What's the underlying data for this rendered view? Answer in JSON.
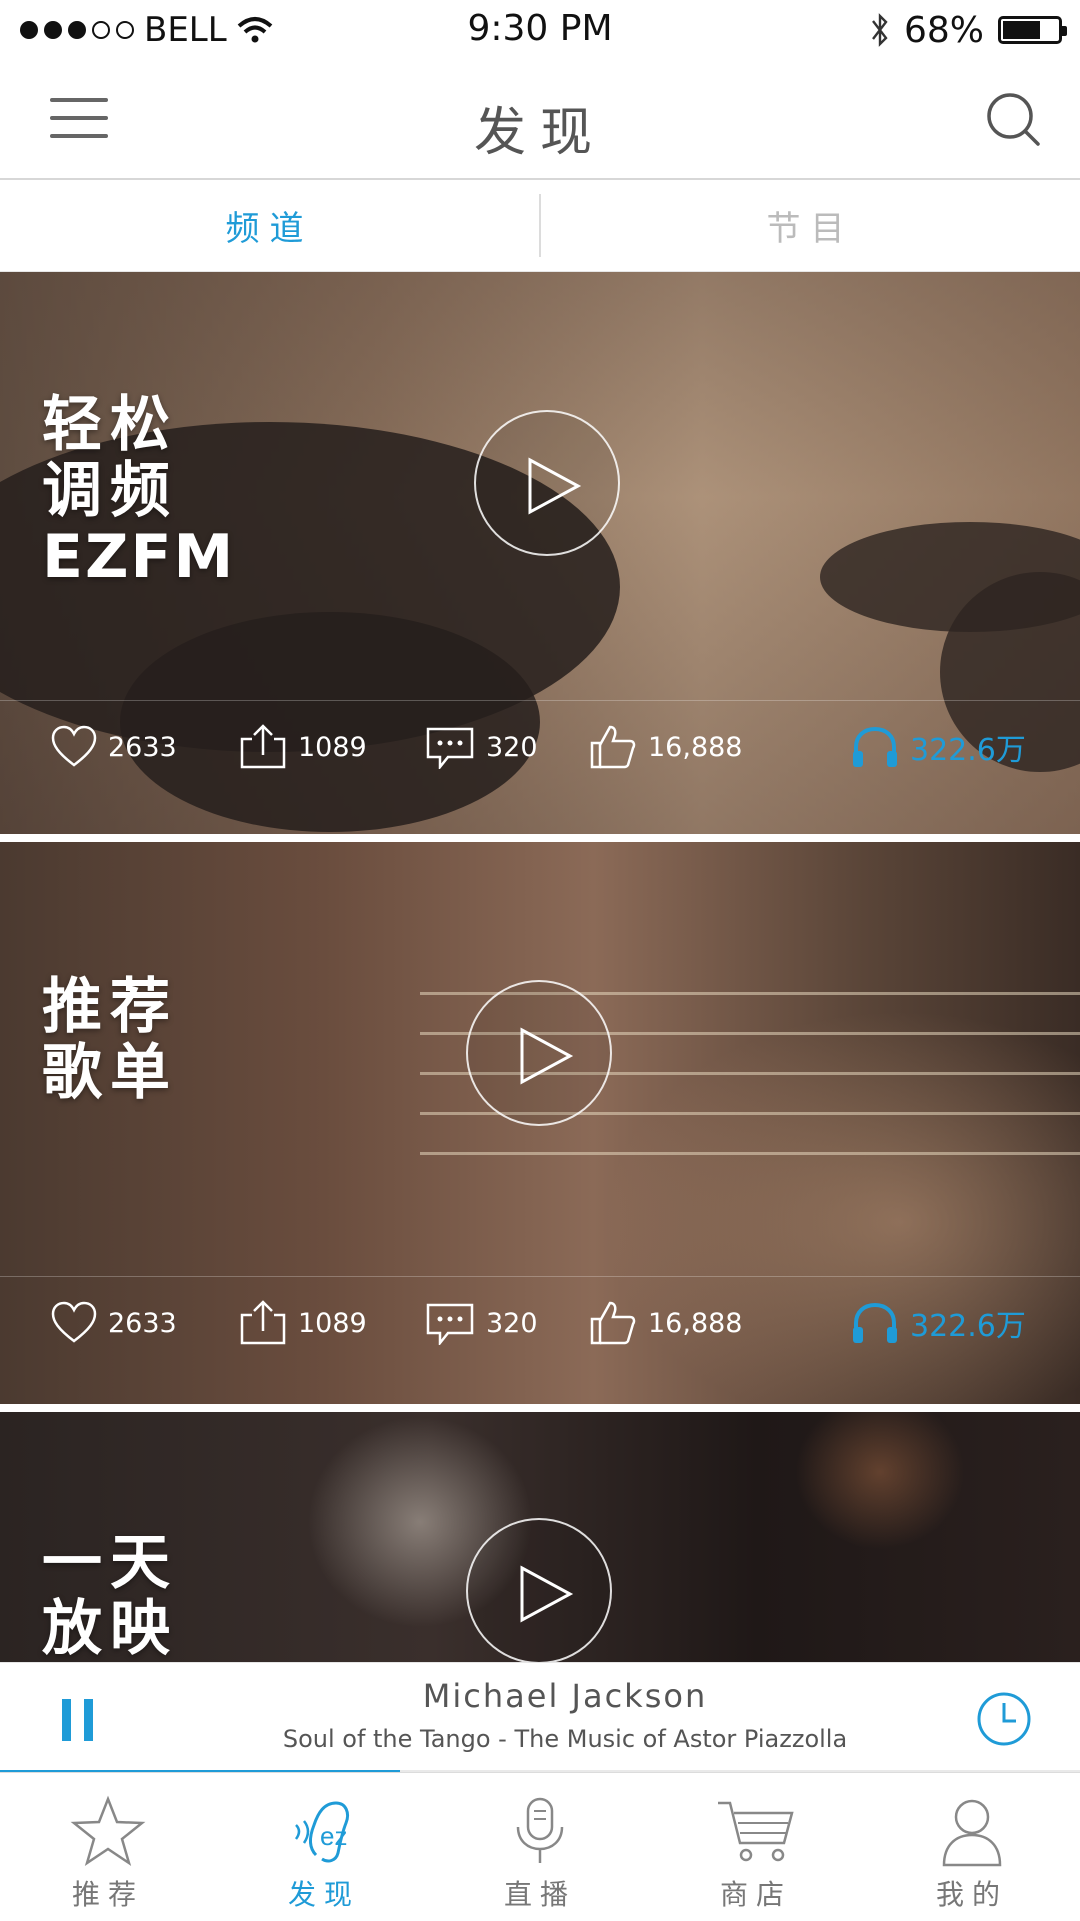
{
  "status_bar": {
    "carrier": "BELL",
    "time": "9:30 PM",
    "battery_percent": "68%",
    "battery_level": 0.68
  },
  "nav": {
    "title": "发现"
  },
  "tabs": [
    {
      "label": "频道",
      "active": true
    },
    {
      "label": "节目",
      "active": false
    }
  ],
  "cards": [
    {
      "title_lines": [
        "轻松",
        "调频",
        "EZFM"
      ],
      "likes": "2633",
      "shares": "1089",
      "comments": "320",
      "thumbs": "16,888",
      "listens": "322.6万"
    },
    {
      "title_lines": [
        "推荐",
        "歌单"
      ],
      "likes": "2633",
      "shares": "1089",
      "comments": "320",
      "thumbs": "16,888",
      "listens": "322.6万"
    },
    {
      "title_lines": [
        "一天",
        "放映"
      ]
    }
  ],
  "player": {
    "artist": "Michael Jackson",
    "song": "Soul of the Tango - The Music of Astor Piazzolla",
    "progress": 0.37
  },
  "tabbar": [
    {
      "label": "推荐",
      "icon": "star-icon",
      "active": false
    },
    {
      "label": "发现",
      "icon": "ez-ear-icon",
      "active": true
    },
    {
      "label": "直播",
      "icon": "microphone-icon",
      "active": false
    },
    {
      "label": "商店",
      "icon": "cart-icon",
      "active": false
    },
    {
      "label": "我的",
      "icon": "person-icon",
      "active": false
    }
  ],
  "colors": {
    "accent": "#1f9bd7",
    "text": "#555555",
    "divider": "#dcdcdc"
  }
}
